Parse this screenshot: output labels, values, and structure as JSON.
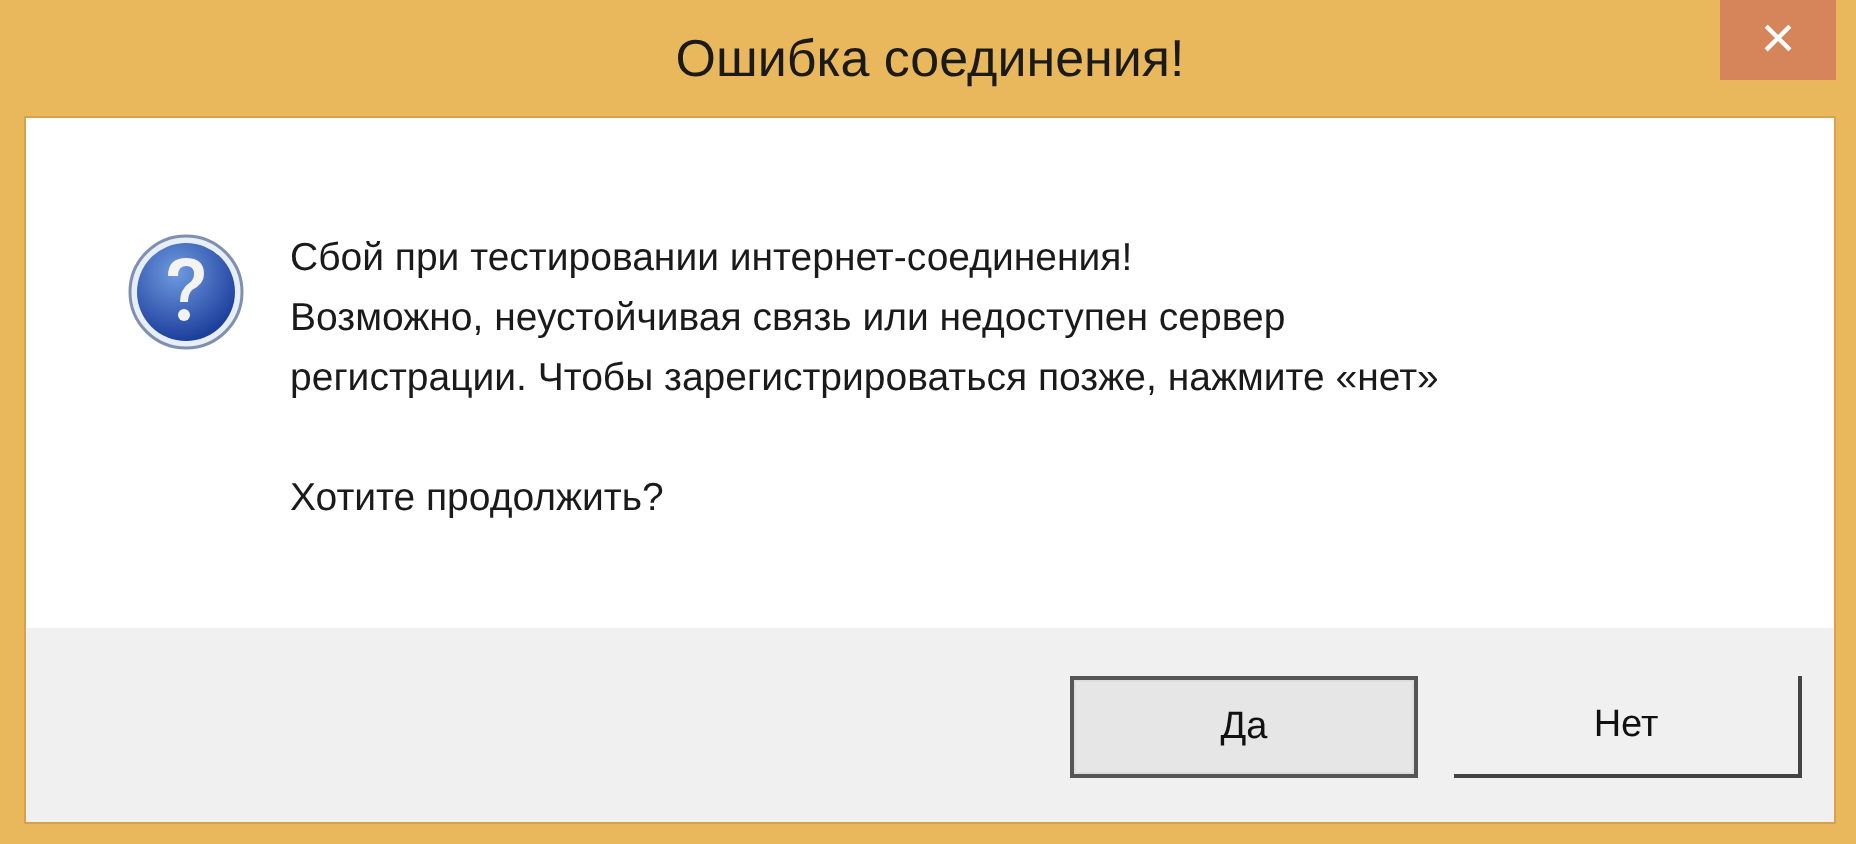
{
  "window": {
    "title": "Ошибка соединения!",
    "close": "×"
  },
  "message": {
    "lines": [
      "Сбой при тестировании интернет-соединения!",
      "Возможно, неустойчивая связь или недоступен сервер",
      "регистрации. Чтобы зарегистрироваться позже, нажмите «нет»"
    ],
    "question": "Хотите продолжить?"
  },
  "buttons": [
    {
      "label": "Да",
      "default": true
    },
    {
      "label": "Нет",
      "default": false
    }
  ]
}
